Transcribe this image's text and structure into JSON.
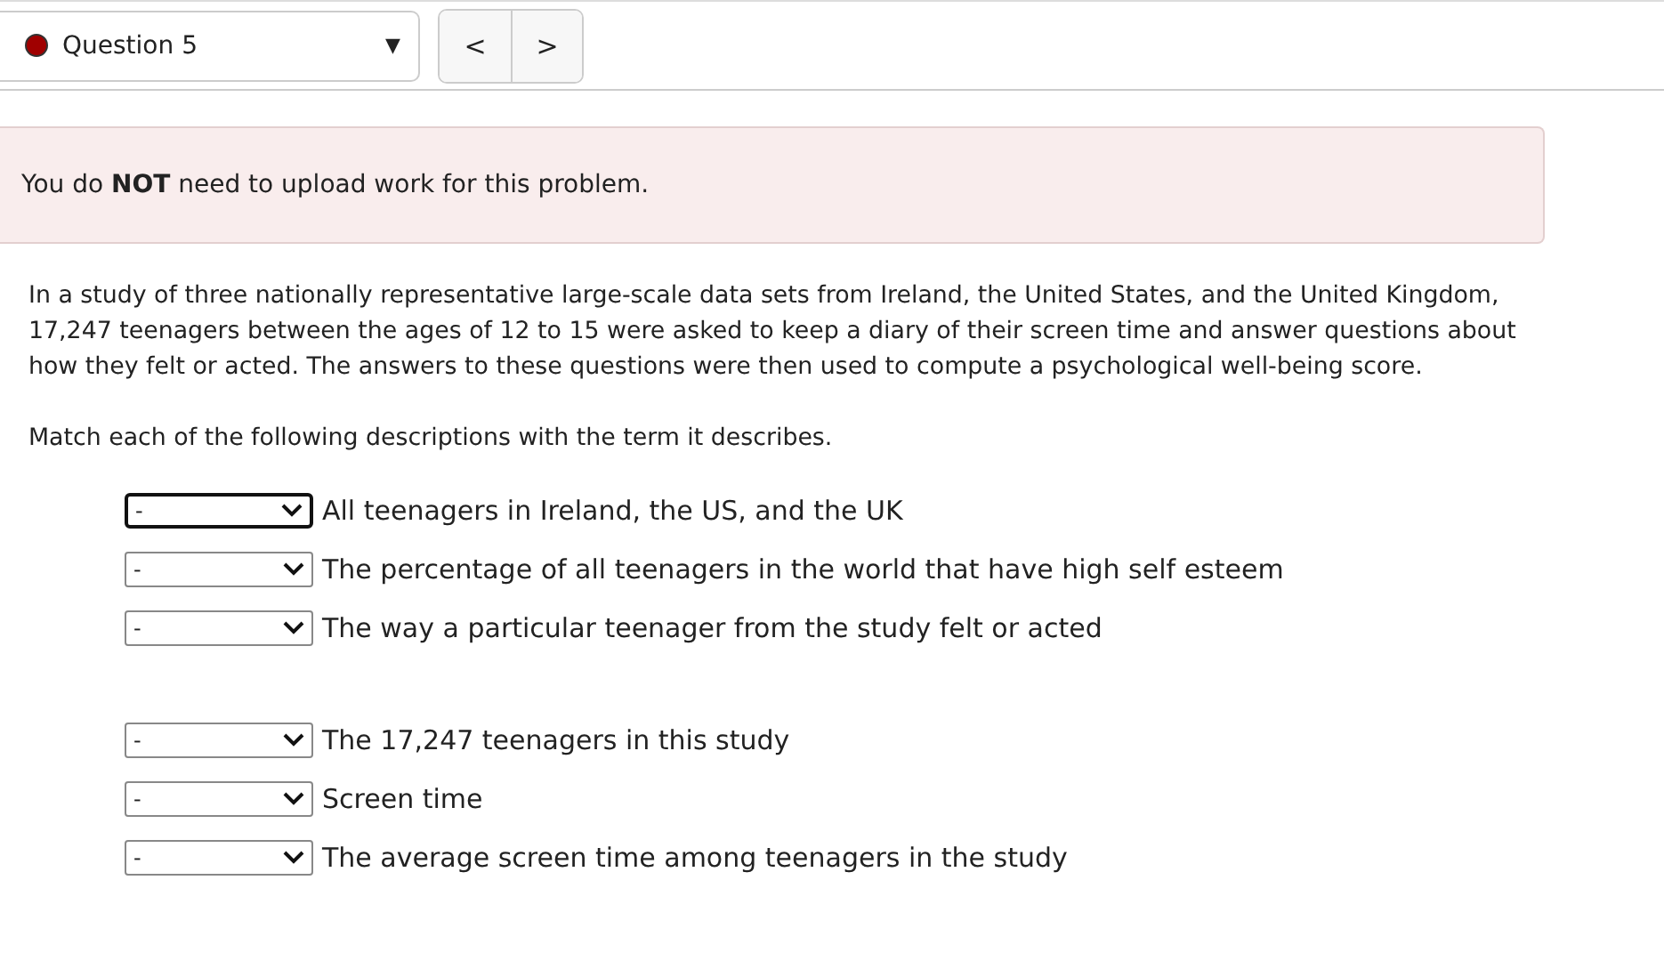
{
  "question_nav": {
    "label": "Question 5",
    "caret": "▼",
    "prev": "<",
    "next": ">"
  },
  "notice": "You do **NOT** need to upload work for this problem.",
  "paragraphs": [
    "In a study of three nationally representative large-scale data sets from Ireland, the United States, and the United Kingdom, 17,247 teenagers between the ages of 12 to 15 were asked to keep a diary of their screen time and answer questions about how they felt or acted. The answers to these questions were then used to compute a psychological well-being score.",
    "Match each of the following descriptions with the term it describes."
  ],
  "match_groups": [
    [
      {
        "value": "-",
        "focused": true,
        "description": "All teenagers in Ireland, the US, and the UK"
      },
      {
        "value": "-",
        "focused": false,
        "description": "The percentage of all teenagers in the world that have high self esteem"
      },
      {
        "value": "-",
        "focused": false,
        "description": "The way a particular teenager from the study felt or acted"
      }
    ],
    [
      {
        "value": "-",
        "focused": false,
        "description": "The 17,247 teenagers in this study"
      },
      {
        "value": "-",
        "focused": false,
        "description": "Screen time"
      },
      {
        "value": "-",
        "focused": false,
        "description": "The average screen time among teenagers in the study"
      }
    ]
  ]
}
